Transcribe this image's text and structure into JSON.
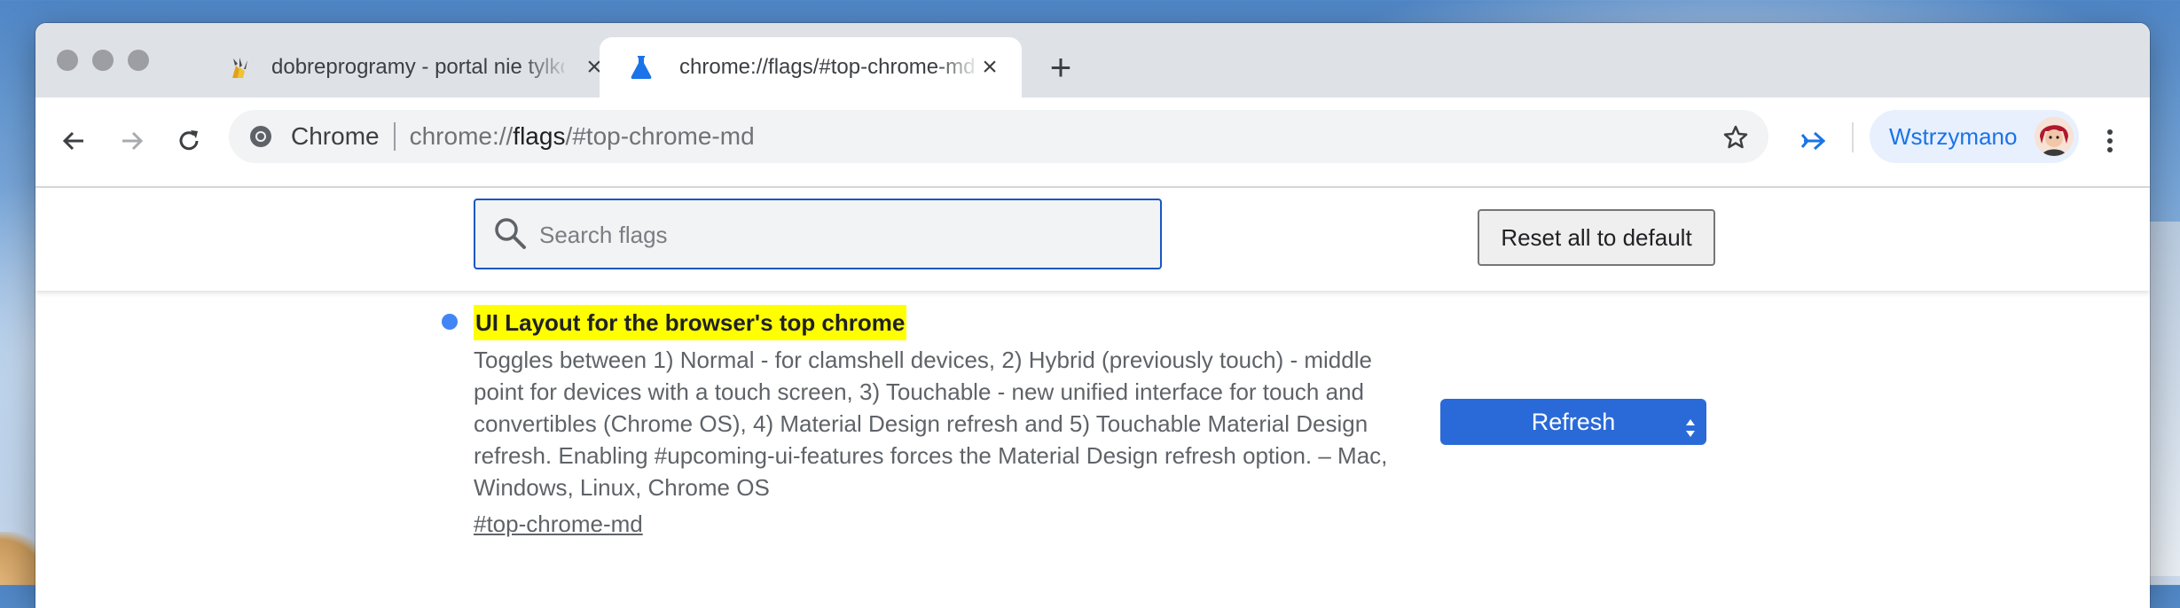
{
  "tabs": [
    {
      "title": "dobreprogramy - portal nie tylko o programach",
      "icon": "dobreprogramy-favicon",
      "active": false
    },
    {
      "title": "chrome://flags/#top-chrome-md",
      "icon": "flask-icon",
      "active": true
    }
  ],
  "omnibox": {
    "site_label": "Chrome",
    "url_prefix": "chrome://",
    "url_host": "flags",
    "url_suffix": "/#top-chrome-md"
  },
  "profile": {
    "label": "Wstrzymano"
  },
  "search": {
    "placeholder": "Search flags",
    "value": ""
  },
  "reset_button": {
    "label": "Reset all to default"
  },
  "flag": {
    "title": "UI Layout for the browser's top chrome",
    "description_lines": [
      "Toggles between 1) Normal - for clamshell devices, 2) Hybrid (previously touch) - middle",
      "point for devices with a touch screen, 3) Touchable - new unified interface for touch and",
      "convertibles (Chrome OS), 4) Material Design refresh and 5) Touchable Material Design",
      "refresh. Enabling #upcoming-ui-features forces the Material Design refresh option. – Mac,",
      "Windows, Linux, Chrome OS"
    ],
    "link": "#top-chrome-md",
    "selected_option": "Refresh"
  },
  "colors": {
    "accent": "#1a73e8",
    "highlight": "#ffff00",
    "select_bg": "#2a6ad8",
    "flag_dot": "#4285f4"
  }
}
